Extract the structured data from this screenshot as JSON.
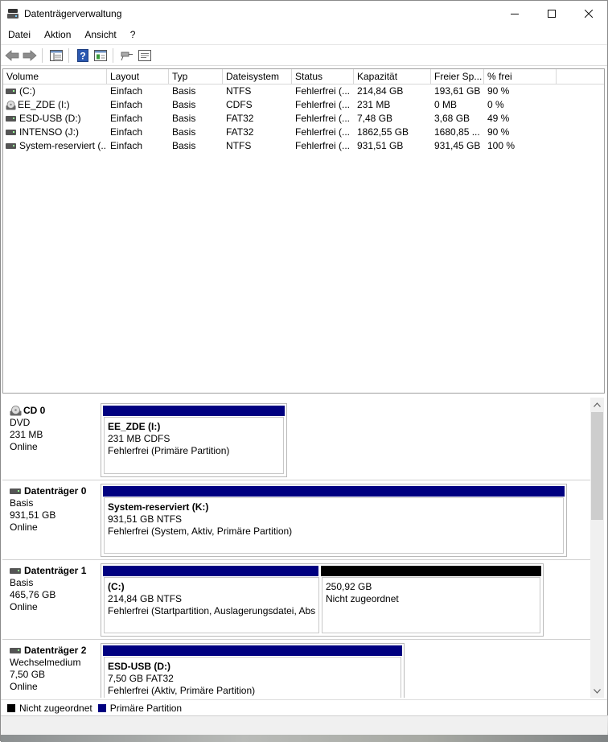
{
  "window": {
    "title": "Datenträgerverwaltung",
    "controls": [
      "minimize",
      "maximize",
      "close"
    ]
  },
  "menu": [
    "Datei",
    "Aktion",
    "Ansicht",
    "?"
  ],
  "toolbar": {
    "icons": [
      "back-arrow-icon",
      "forward-arrow-icon",
      "list-view-icon",
      "help-icon",
      "properties-icon",
      "connect-icon",
      "console-icon"
    ]
  },
  "volume_table": {
    "columns": [
      "Volume",
      "Layout",
      "Typ",
      "Dateisystem",
      "Status",
      "Kapazität",
      "Freier Sp...",
      "% frei"
    ],
    "rows": [
      {
        "volume": " (C:)",
        "icon": "drive-icon",
        "layout": "Einfach",
        "typ": "Basis",
        "fs": "NTFS",
        "status": "Fehlerfrei (...",
        "capacity": "214,84 GB",
        "free": "193,61 GB",
        "pct": "90 %"
      },
      {
        "volume": "EE_ZDE (I:)",
        "icon": "cd-icon",
        "layout": "Einfach",
        "typ": "Basis",
        "fs": "CDFS",
        "status": "Fehlerfrei (...",
        "capacity": "231 MB",
        "free": "0 MB",
        "pct": "0 %"
      },
      {
        "volume": "ESD-USB (D:)",
        "icon": "drive-icon",
        "layout": "Einfach",
        "typ": "Basis",
        "fs": "FAT32",
        "status": "Fehlerfrei (...",
        "capacity": "7,48 GB",
        "free": "3,68 GB",
        "pct": "49 %"
      },
      {
        "volume": "INTENSO (J:)",
        "icon": "drive-icon",
        "layout": "Einfach",
        "typ": "Basis",
        "fs": "FAT32",
        "status": "Fehlerfrei (...",
        "capacity": "1862,55 GB",
        "free": "1680,85 ...",
        "pct": "90 %"
      },
      {
        "volume": "System-reserviert (...",
        "icon": "drive-icon",
        "layout": "Einfach",
        "typ": "Basis",
        "fs": "NTFS",
        "status": "Fehlerfrei (...",
        "capacity": "931,51 GB",
        "free": "931,45 GB",
        "pct": "100 %"
      }
    ]
  },
  "disks": [
    {
      "name": "CD 0",
      "icon": "cd-icon",
      "type": "DVD",
      "size": "231 MB",
      "state": "Online",
      "partitions": [
        {
          "name": "EE_ZDE  (I:)",
          "size": "231 MB CDFS",
          "status": "Fehlerfrei (Primäre Partition)",
          "kind": "primary"
        }
      ]
    },
    {
      "name": "Datenträger 0",
      "icon": "drive-icon",
      "type": "Basis",
      "size": "931,51 GB",
      "state": "Online",
      "partitions": [
        {
          "name": "System-reserviert  (K:)",
          "size": "931,51 GB NTFS",
          "status": "Fehlerfrei (System, Aktiv, Primäre Partition)",
          "kind": "primary"
        }
      ]
    },
    {
      "name": "Datenträger 1",
      "icon": "drive-icon",
      "type": "Basis",
      "size": "465,76 GB",
      "state": "Online",
      "partitions": [
        {
          "name": " (C:)",
          "size": "214,84 GB NTFS",
          "status": "Fehlerfrei (Startpartition, Auslagerungsdatei, Abs",
          "kind": "primary"
        },
        {
          "name": "",
          "size": "250,92 GB",
          "status": "Nicht zugeordnet",
          "kind": "unallocated"
        }
      ]
    },
    {
      "name": "Datenträger 2",
      "icon": "drive-icon",
      "type": "Wechselmedium",
      "size": "7,50 GB",
      "state": "Online",
      "partitions": [
        {
          "name": "ESD-USB  (D:)",
          "size": "7,50 GB FAT32",
          "status": "Fehlerfrei (Aktiv, Primäre Partition)",
          "kind": "primary"
        }
      ]
    }
  ],
  "legend": [
    {
      "label": "Nicht zugeordnet",
      "color": "#000000"
    },
    {
      "label": "Primäre Partition",
      "color": "#000080"
    }
  ],
  "colors": {
    "primary_partition": "#000080",
    "unallocated": "#000000"
  }
}
